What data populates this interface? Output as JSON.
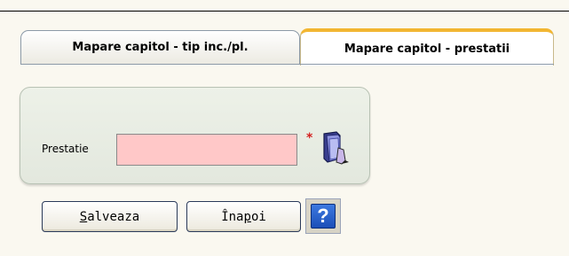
{
  "tabs": [
    {
      "label": "Mapare capitol - tip inc./pl.",
      "active": false
    },
    {
      "label": "Mapare capitol - prestatii",
      "active": true
    }
  ],
  "form": {
    "prestatie_label": "Prestatie",
    "prestatie_value": "",
    "required_mark": "*",
    "lookup_icon": "folder-lookup-icon"
  },
  "buttons": {
    "save": {
      "mnemonic": "S",
      "rest": "alveaza"
    },
    "back": {
      "pre": "Îna",
      "mnemonic": "p",
      "post": "oi"
    },
    "help_glyph": "?"
  },
  "colors": {
    "required_field_bg": "#ffc8c8",
    "active_tab_accent": "#f2b632",
    "help_blue": "#2a62cc"
  }
}
